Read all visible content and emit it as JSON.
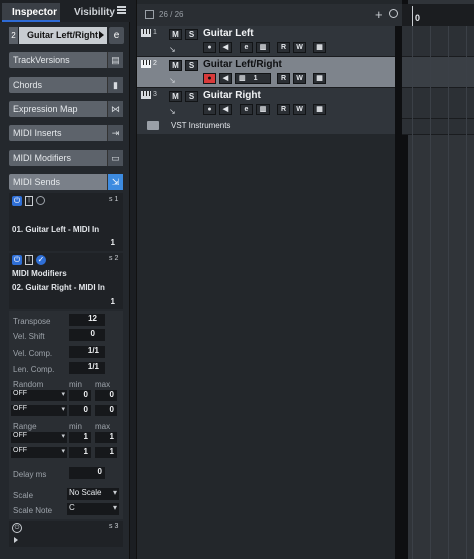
{
  "inspector": {
    "tabs": [
      "Inspector",
      "Visibility"
    ],
    "track": {
      "number": "2",
      "name": "Guitar Left/Right"
    },
    "sections": [
      {
        "label": "TrackVersions"
      },
      {
        "label": "Chords"
      },
      {
        "label": "Expression Map"
      },
      {
        "label": "MIDI Inserts"
      },
      {
        "label": "MIDI Modifiers"
      },
      {
        "label": "MIDI Sends"
      }
    ],
    "sends": [
      {
        "slot_label": "s 1",
        "name": "01. Guitar Left - MIDI In",
        "channel": "1"
      },
      {
        "slot_label": "s 2",
        "heading": "MIDI Modifiers",
        "name": "02. Guitar Right - MIDI In",
        "channel": "1"
      }
    ],
    "modifiers": {
      "transpose_label": "Transpose",
      "transpose": "12",
      "vel_shift_label": "Vel. Shift",
      "vel_shift": "0",
      "vel_comp_label": "Vel. Comp.",
      "vel_comp": "1/1",
      "len_comp_label": "Len. Comp.",
      "len_comp": "1/1",
      "random_label": "Random",
      "min_label": "min",
      "max_label": "max",
      "random_rows": [
        {
          "mode": "OFF",
          "min": "0",
          "max": "0"
        },
        {
          "mode": "OFF",
          "min": "0",
          "max": "0"
        }
      ],
      "range_label": "Range",
      "range_rows": [
        {
          "mode": "OFF",
          "min": "1",
          "max": "1"
        },
        {
          "mode": "OFF",
          "min": "1",
          "max": "1"
        }
      ],
      "delay_label": "Delay ms",
      "delay": "0",
      "scale_label": "Scale",
      "scale": "No Scale",
      "scale_note_label": "Scale Note",
      "scale_note": "C"
    },
    "footer_slot": "s 3"
  },
  "tracklist": {
    "count": "26 / 26",
    "tracks": [
      {
        "number": "1",
        "name": "Guitar Left",
        "selected": false,
        "record_enabled": false
      },
      {
        "number": "2",
        "name": "Guitar Left/Right",
        "selected": true,
        "record_enabled": true,
        "lane_label": "1"
      },
      {
        "number": "3",
        "name": "Guitar Right",
        "selected": false,
        "record_enabled": false
      }
    ],
    "folder": {
      "name": "VST Instruments"
    }
  },
  "ruler": {
    "start": "0"
  },
  "colors": {
    "accent": "#2e6bd6",
    "record": "#d83a3a",
    "selected_track": "#7e848c"
  }
}
